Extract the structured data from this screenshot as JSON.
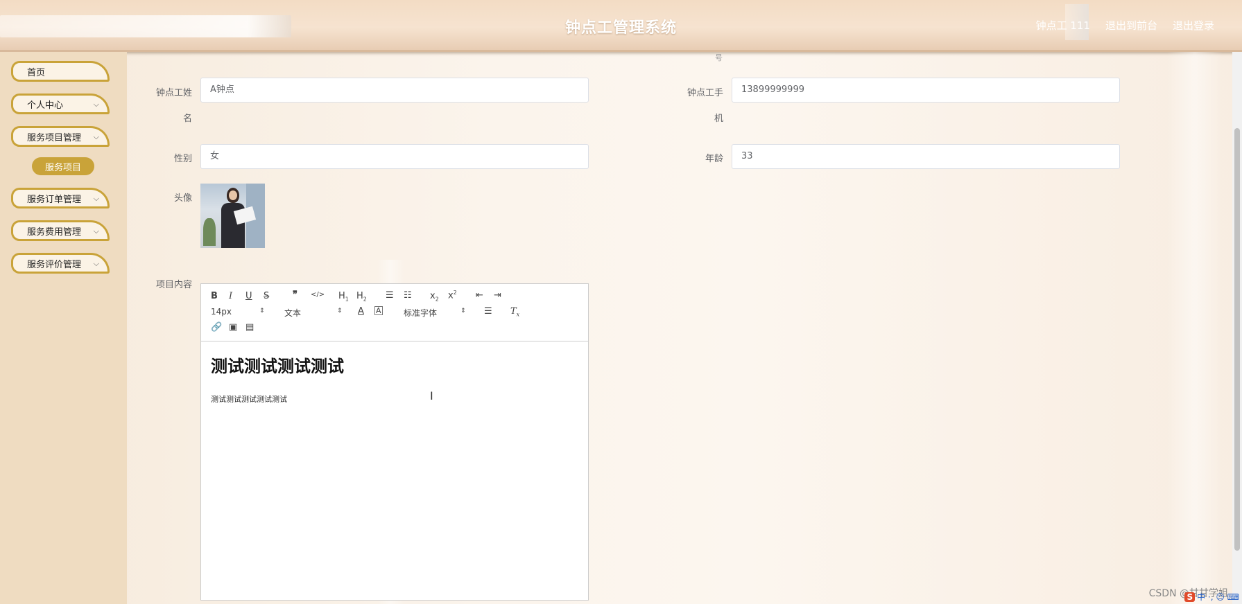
{
  "header": {
    "title": "钟点工管理系统",
    "user": "钟点工 111",
    "to_front": "退出到前台",
    "logout": "退出登录"
  },
  "sidebar": {
    "items": [
      {
        "label": "首页"
      },
      {
        "label": "个人中心"
      },
      {
        "label": "服务项目管理"
      },
      {
        "label": "服务订单管理"
      },
      {
        "label": "服务费用管理"
      },
      {
        "label": "服务评价管理"
      }
    ],
    "sub_active": "服务项目"
  },
  "form": {
    "top_fragment": "号",
    "name_label_1": "钟点工姓",
    "name_label_2": "名",
    "name_value": "A钟点",
    "phone_label_1": "钟点工手",
    "phone_label_2": "机",
    "phone_value": "13899999999",
    "gender_label": "性别",
    "gender_value": "女",
    "age_label": "年龄",
    "age_value": "33",
    "avatar_label": "头像",
    "content_label": "项目内容"
  },
  "editor": {
    "font_size": "14px",
    "block_type": "文本",
    "font_family": "标准字体",
    "heading": "测试测试测试测试",
    "paragraph": "测试测试测试测试测试"
  },
  "footer": {
    "watermark": "CSDN @甘甘学姐",
    "ime": "中 ·, ☺ ⌨"
  },
  "colors": {
    "accent": "#c9a339",
    "sidebar_bg": "#efdcc1",
    "header_bg": "#f3dcc4"
  }
}
